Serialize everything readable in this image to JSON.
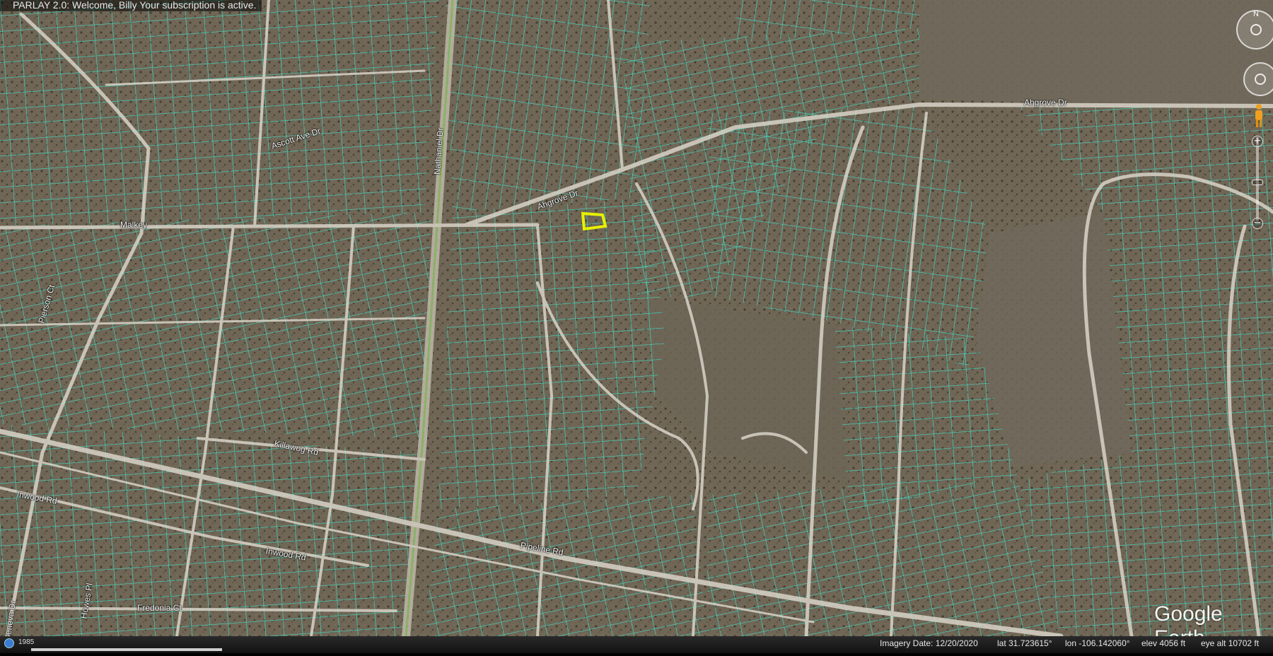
{
  "banner": {
    "text": "PARLAY 2.0: Welcome, Billy Your subscription is active."
  },
  "roads": [
    {
      "id": "road-ascott",
      "text": "Ascott Ave Dr"
    },
    {
      "id": "road-nathaniel",
      "text": "Nathaniel Dr"
    },
    {
      "id": "road-malkey",
      "text": "Malkey"
    },
    {
      "id": "road-ahgrove-1",
      "text": "Ahgrove Dr"
    },
    {
      "id": "road-ahgrove-2",
      "text": "Ahgrove Dr"
    },
    {
      "id": "road-pierson",
      "text": "Pierson Ct"
    },
    {
      "id": "road-killawog",
      "text": "Killawog Rd"
    },
    {
      "id": "road-inwood-1",
      "text": "Inwood Rd"
    },
    {
      "id": "road-inwood-2",
      "text": "Inwood Rd"
    },
    {
      "id": "road-pipeline",
      "text": "Pipeline Rd"
    },
    {
      "id": "road-fredonia",
      "text": "Fredonia Ct"
    },
    {
      "id": "road-howes",
      "text": "Howes Pl"
    },
    {
      "id": "road-geneva",
      "text": "Geneva Dr"
    }
  ],
  "compass": {
    "north_letter": "N"
  },
  "zoom": {
    "plus": "+",
    "minus": "−",
    "level_fraction": 0.6
  },
  "logo": {
    "text": "Google Earth"
  },
  "status": {
    "year": "1985",
    "imagery_date": "Imagery Date: 12/20/2020",
    "lat": "lat   31.723615°",
    "lon": "lon -106.142060°",
    "elev": "elev  4056 ft",
    "eye_alt": "eye alt  10702 ft"
  },
  "colors": {
    "parcel_lines": "#3fe0c8",
    "terrain": "#6f6656",
    "roads": "#d9d4c8",
    "selected_parcel": "#e6f000"
  },
  "icons": {
    "compass": "compass-icon",
    "look": "look-around-icon",
    "pegman": "pegman-icon",
    "globe": "globe-icon"
  },
  "loading_progress": 0.27
}
